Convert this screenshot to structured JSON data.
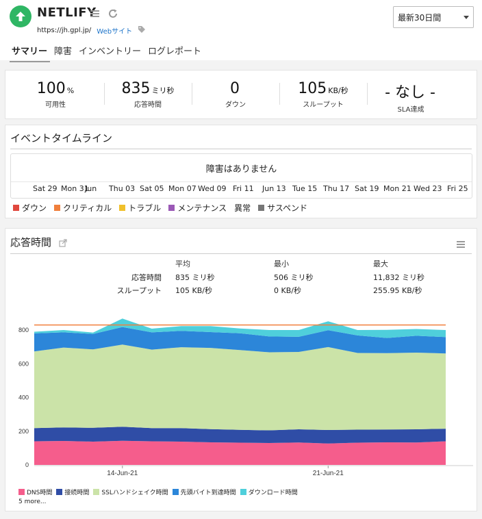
{
  "monitor": {
    "name": "NETLIFY",
    "url": "https://jh.gpl.jp/",
    "type_link": "Webサイト"
  },
  "period": {
    "selected": "最新30日間"
  },
  "tabs": [
    {
      "label": "サマリー",
      "active": true
    },
    {
      "label": "障害",
      "active": false
    },
    {
      "label": "インベントリー",
      "active": false
    },
    {
      "label": "ログレポート",
      "active": false
    }
  ],
  "stats": [
    {
      "value": "100",
      "unit": "%",
      "label": "可用性"
    },
    {
      "value": "835",
      "unit": "ミリ秒",
      "label": "応答時間"
    },
    {
      "value": "0",
      "unit": "",
      "label": "ダウン"
    },
    {
      "value": "105",
      "unit": "KB/秒",
      "label": "スループット"
    },
    {
      "value": "- なし -",
      "unit": "",
      "label": "SLA達成"
    }
  ],
  "timeline": {
    "title": "イベントタイムライン",
    "message": "障害はありません",
    "ticks": [
      "Sat 29",
      "Mon 31",
      "Jun",
      "Thu 03",
      "Sat 05",
      "Mon 07",
      "Wed 09",
      "Fri 11",
      "Jun 13",
      "Tue 15",
      "Thu 17",
      "Sat 19",
      "Mon 21",
      "Wed 23",
      "Fri 25"
    ],
    "legend": [
      {
        "label": "ダウン",
        "color": "#e0483e"
      },
      {
        "label": "クリティカル",
        "color": "#f07f3c"
      },
      {
        "label": "トラブル",
        "color": "#f0c02c"
      },
      {
        "label": "メンテナンス",
        "color": "#9b59b6"
      },
      {
        "label": "異常",
        "color": ""
      },
      {
        "label": "サスペンド",
        "color": "#777777"
      }
    ]
  },
  "response": {
    "title": "応答時間",
    "headers": [
      "平均",
      "最小",
      "最大"
    ],
    "rows": [
      {
        "label": "応答時間",
        "avg": "835 ミリ秒",
        "min": "506 ミリ秒",
        "max": "11,832 ミリ秒"
      },
      {
        "label": "スループット",
        "avg": "105 KB/秒",
        "min": "0 KB/秒",
        "max": "255.95 KB/秒"
      }
    ],
    "more": "5 more..."
  },
  "chart_data": {
    "type": "area",
    "stacked": true,
    "ylim": [
      0,
      800
    ],
    "yticks": [
      0,
      200,
      400,
      600,
      800
    ],
    "xlabels": [
      {
        "label": "14-Jun-21",
        "index": 3
      },
      {
        "label": "21-Jun-21",
        "index": 10
      }
    ],
    "reference_line": {
      "value": 830,
      "color": "#f07f3c"
    },
    "series": [
      {
        "name": "DNS時間",
        "color": "#f55d8c",
        "values": [
          140,
          142,
          138,
          143,
          140,
          138,
          134,
          132,
          130,
          133,
          127,
          132,
          134,
          133,
          140
        ]
      },
      {
        "name": "接続時間",
        "color": "#2f4da6",
        "values": [
          78,
          80,
          82,
          83,
          78,
          80,
          78,
          76,
          75,
          78,
          80,
          77,
          76,
          78,
          75
        ]
      },
      {
        "name": "SSLハンドシェイク時間",
        "color": "#cbe3a8",
        "values": [
          455,
          474,
          465,
          488,
          466,
          480,
          482,
          473,
          463,
          459,
          492,
          455,
          453,
          455,
          446
        ]
      },
      {
        "name": "先頭バイト到達時間",
        "color": "#2c86d9",
        "values": [
          107,
          90,
          92,
          104,
          102,
          97,
          94,
          100,
          94,
          90,
          100,
          104,
          90,
          100,
          97
        ]
      },
      {
        "name": "ダウンロード時間",
        "color": "#4fcfdb",
        "values": [
          10,
          14,
          8,
          50,
          22,
          28,
          35,
          28,
          38,
          40,
          53,
          32,
          48,
          40,
          42
        ]
      }
    ]
  }
}
